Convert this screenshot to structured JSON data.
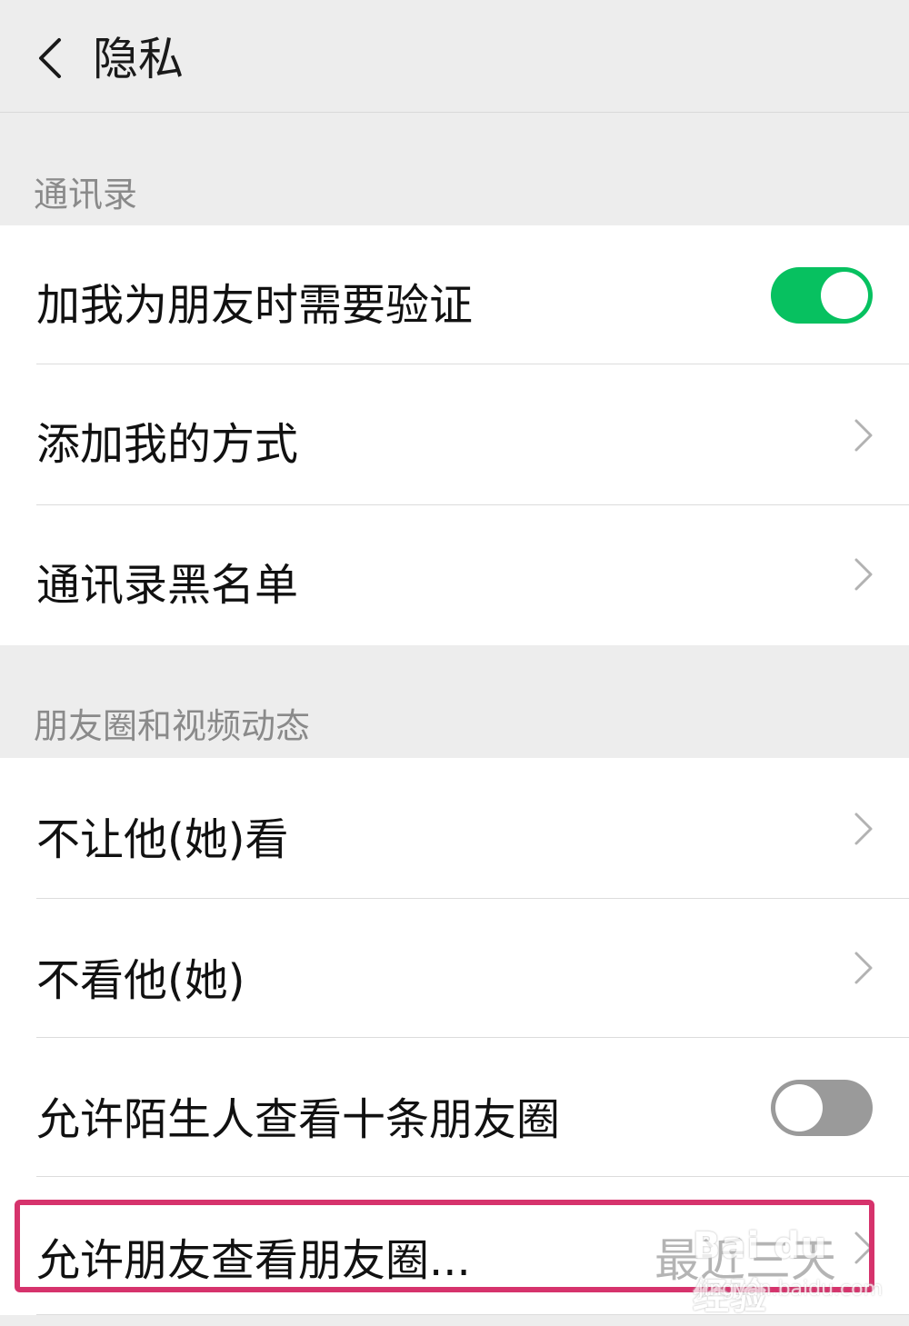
{
  "header": {
    "title": "隐私"
  },
  "sections": {
    "contacts": {
      "title": "通讯录",
      "items": {
        "verify": {
          "label": "加我为朋友时需要验证",
          "toggle_on": true
        },
        "add_methods": {
          "label": "添加我的方式"
        },
        "blacklist": {
          "label": "通讯录黑名单"
        }
      }
    },
    "moments": {
      "title": "朋友圈和视频动态",
      "items": {
        "hide_from": {
          "label": "不让他(她)看"
        },
        "dont_see": {
          "label": "不看他(她)"
        },
        "strangers_ten": {
          "label": "允许陌生人查看十条朋友圈",
          "toggle_on": false
        },
        "friends_range": {
          "label": "允许朋友查看朋友圈...",
          "value": "最近三天"
        }
      }
    }
  },
  "watermark": {
    "brand": "Bai du 经验",
    "url": "jingyan.baidu.com"
  },
  "colors": {
    "toggle_on": "#07c160",
    "toggle_off": "#9a9a9a",
    "highlight": "#d6336c",
    "background": "#ededed"
  }
}
